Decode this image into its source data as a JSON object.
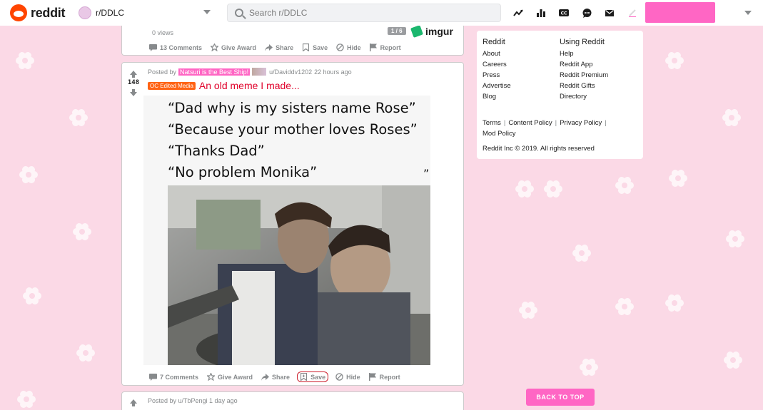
{
  "header": {
    "logo_text": "reddit",
    "subreddit": "r/DDLC",
    "search_placeholder": "Search r/DDLC",
    "icons": [
      "trending-icon",
      "stats-icon",
      "cc-icon",
      "chat-icon",
      "mail-icon",
      "pen-icon"
    ]
  },
  "posts": [
    {
      "views": "0 views",
      "gallery_count": "1 / 6",
      "source": "imgur",
      "comments": "13 Comments",
      "give_award": "Give Award",
      "share": "Share",
      "save": "Save",
      "hide": "Hide",
      "report": "Report"
    },
    {
      "score": "148",
      "posted_by_prefix": "Posted by",
      "user_flair": "Natsuri is the Best Ship!",
      "author": "u/Daviddv1202",
      "time": "22 hours ago",
      "post_flair": "OC Edited Media",
      "title": "An old meme I made...",
      "meme_lines": [
        "“Dad why is my sisters name Rose”",
        "“Because your mother loves Roses”",
        "“Thanks Dad”",
        "“No problem Monika”"
      ],
      "meme_quote_end": "”",
      "comments": "7 Comments",
      "give_award": "Give Award",
      "share": "Share",
      "save": "Save",
      "hide": "Hide",
      "report": "Report"
    },
    {
      "posted_by": "Posted by u/TbPengi 1 day ago"
    }
  ],
  "sidebar": {
    "col1_title": "Reddit",
    "col1_links": [
      "About",
      "Careers",
      "Press",
      "Advertise",
      "Blog"
    ],
    "col2_title": "Using Reddit",
    "col2_links": [
      "Help",
      "Reddit App",
      "Reddit Premium",
      "Reddit Gifts",
      "Directory"
    ],
    "legal": [
      "Terms",
      "Content Policy",
      "Privacy Policy",
      "Mod Policy"
    ],
    "legal_separator": "|",
    "copyright": "Reddit Inc © 2019. All rights reserved"
  },
  "back_to_top": "BACK TO TOP",
  "colors": {
    "accent_pink": "#ff66c4",
    "background": "#fbd9e6",
    "title_red": "#e0002a",
    "post_flair_orange": "#ff6314",
    "highlight_red": "#cc1d2b"
  }
}
